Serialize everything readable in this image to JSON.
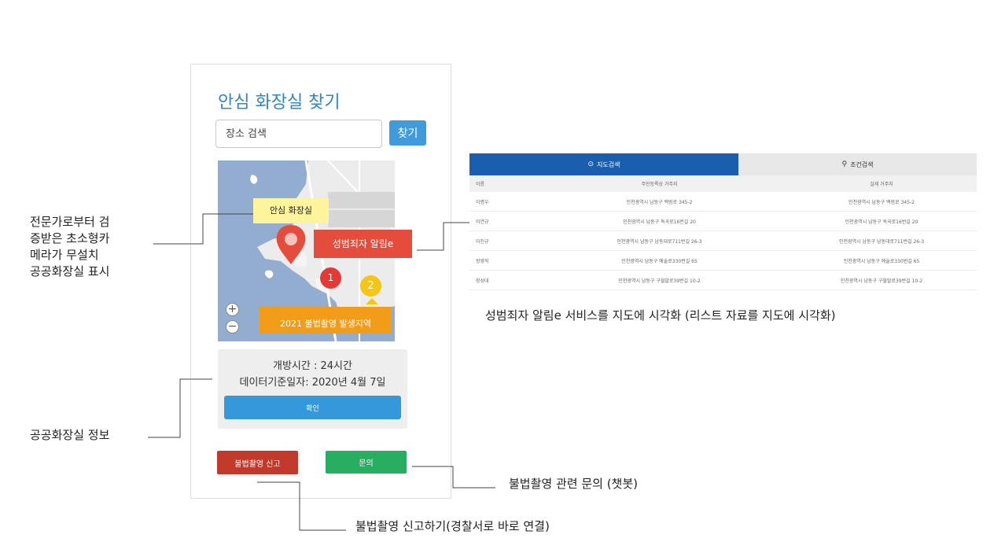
{
  "app": {
    "title": "안심 화장실 찾기",
    "search": {
      "placeholder": "장소 검색",
      "button_label": "찾기"
    },
    "map": {
      "safe_toilet_label": "안심 화장실",
      "offender_label": "성범죄자 알림e",
      "marker_1": "1",
      "marker_2": "2",
      "area_label": "2021 불법촬영 발생지역",
      "zoom_in": "+",
      "zoom_out": "−"
    },
    "info": {
      "open_hours": "개방시간 : 24시간",
      "data_date": "데이터기준일자:  2020년 4월 7일",
      "confirm_label": "확인"
    },
    "report_label": "불법촬영 신고",
    "inquiry_label": "문의"
  },
  "annotations": {
    "camera_lines": [
      "전문가로부터 검",
      "증받은 초소형카",
      "메라가 무설치",
      "공공화장실 표시"
    ],
    "info": "공공화장실 정보",
    "inquiry": "불법촬영 관련 문의 (챗봇)",
    "report": "불법촬영 신고하기(경찰서로 바로 연결)",
    "offender_service": "성범죄자 알림e 서비스를 지도에 시각화 (리스트 자료를 지도에 시각화)"
  },
  "table": {
    "tabs": {
      "map_search": "지도검색",
      "condition_search": "조건검색"
    },
    "headers": {
      "name": "이름",
      "registered_address": "주민등록상 거주지",
      "actual_address": "실제 거주지"
    },
    "rows": [
      {
        "name": "이병우",
        "registered": "인천광역시 남동구 백범로 345-2",
        "actual": "인천광역시 남동구 백범로 345-2"
      },
      {
        "name": "이연규",
        "registered": "인천광역시 남동구 독곡로16번길 20",
        "actual": "인천광역시 남동구 독곡로16번길 20"
      },
      {
        "name": "이진규",
        "registered": "인천광역시 남동구 남동대로711번길 26-3",
        "actual": "인천광역시 남동구 남동대로711번길 26-3"
      },
      {
        "name": "장영직",
        "registered": "인천광역시 남동구 예술로330번길 65",
        "actual": "인천광역시 남동구 예술로330번길 65"
      },
      {
        "name": "장성대",
        "registered": "인천광역시 남동구 구월말로39번길 10-2",
        "actual": "인천광역시 남동구 구월말로39번길 10-2"
      }
    ]
  },
  "colors": {
    "accent_blue": "#3f9bd9",
    "report_red": "#c0392b",
    "inquiry_green": "#27ae60",
    "offender_red": "#e64c3c",
    "area_orange": "#f39c1a",
    "toilet_yellow": "#fdf49b",
    "tab_blue": "#1a5fae"
  }
}
